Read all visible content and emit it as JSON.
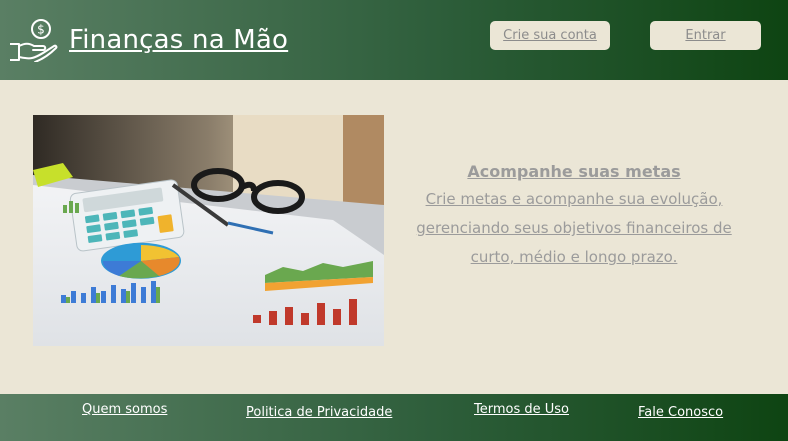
{
  "header": {
    "brand": "Finanças na Mão",
    "logo_icon": "hand-holding-coin-icon",
    "signup_label": "Crie sua conta",
    "login_label": "Entrar"
  },
  "hero": {
    "image": "finance-desk-photo",
    "title": "Acompanhe suas metas",
    "description": "Crie metas e acompanhe sua evolução, gerenciando seus objetivos financeiros de curto, médio e longo prazo."
  },
  "footer": {
    "links": [
      "Quem somos",
      "Politica de Privacidade",
      "Termos de Uso",
      "Fale Conosco"
    ]
  },
  "colors": {
    "background": "#ebe6d6",
    "header_start": "#5a7f64",
    "header_end": "#0e4412",
    "muted_text": "#9b9b9b"
  }
}
